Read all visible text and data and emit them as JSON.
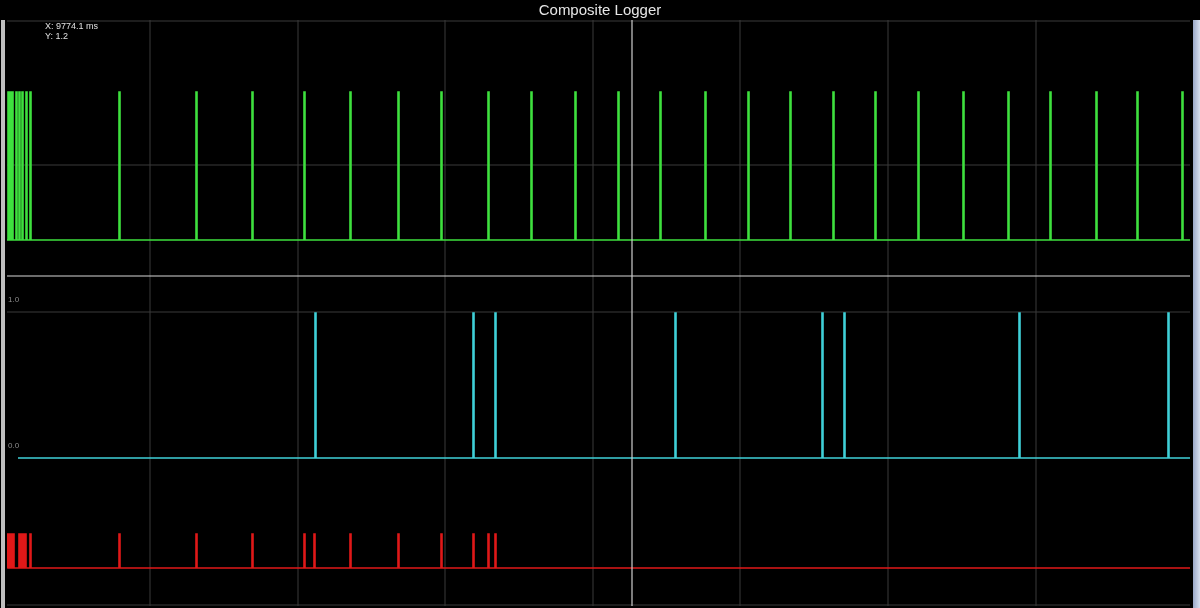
{
  "window": {
    "title": "Composite Logger"
  },
  "cursor": {
    "x_readout": "X: 9774.1 ms",
    "y_readout": "Y: 1.2"
  },
  "traces": [
    {
      "color": "#3ee03e"
    },
    {
      "color": "#3fd0d8",
      "y_ticks": [
        "1.0",
        "0.0"
      ]
    },
    {
      "color": "#e01818"
    }
  ]
}
